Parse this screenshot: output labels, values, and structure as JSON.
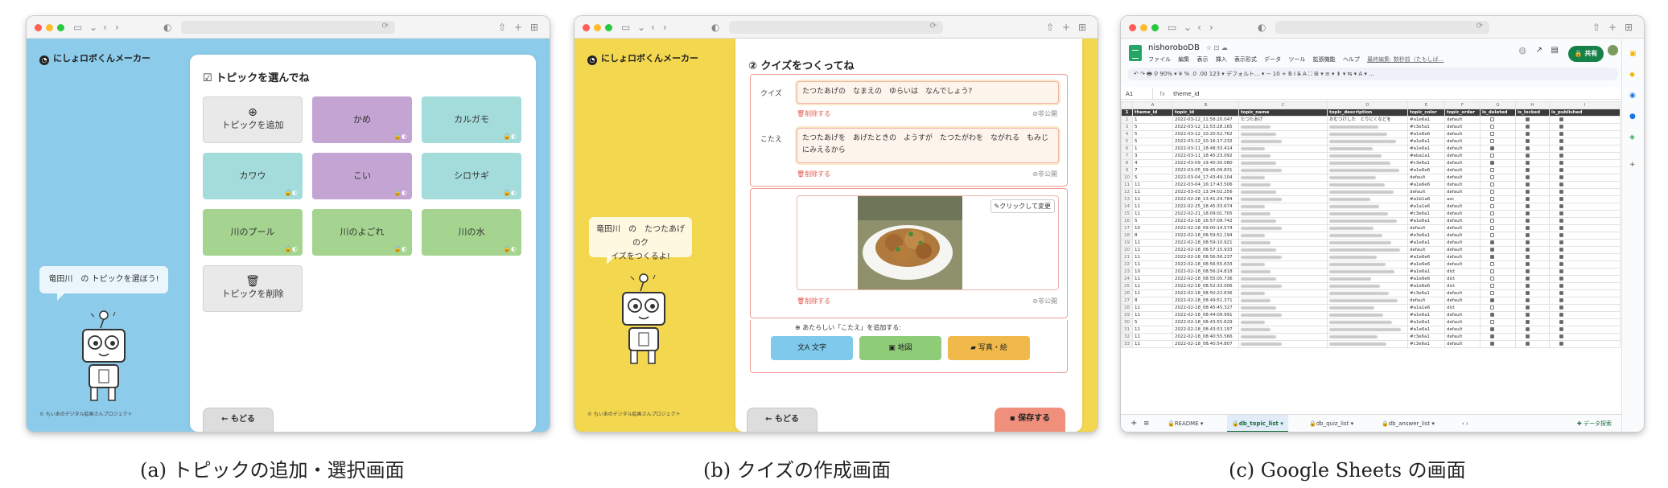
{
  "colors": {
    "sky": "#8ccbea",
    "sun": "#f3d74f",
    "purple": "#c3a4d2",
    "teal": "#a4dcdc",
    "green": "#a4d48f",
    "save": "#ef8f7c",
    "sheet_green": "#17814a"
  },
  "browser": {
    "address_placeholder": "",
    "icons": [
      "sidebar-icon",
      "back-icon",
      "forward-icon",
      "shield-icon",
      "share-icon",
      "new-tab-icon",
      "tabs-overview-icon"
    ]
  },
  "panel_a": {
    "brand": "にしょロボくんメーカー",
    "title": "トピックを選んでね",
    "add_topic": "トピックを追加",
    "delete_topic": "トピックを削除",
    "topics": [
      {
        "label": "かめ",
        "color": "purple"
      },
      {
        "label": "カルガモ",
        "color": "teal"
      },
      {
        "label": "カワウ",
        "color": "teal"
      },
      {
        "label": "こい",
        "color": "purple"
      },
      {
        "label": "シロサギ",
        "color": "teal"
      },
      {
        "label": "川のプール",
        "color": "green"
      },
      {
        "label": "川のよごれ",
        "color": "green"
      },
      {
        "label": "川の水",
        "color": "green"
      }
    ],
    "speech": "竜田川　の トピックを選ぼう!",
    "credit": "© もいあのデジタル絵画さんプロジェクト",
    "back": "← もどる",
    "caption": "(a) トピックの追加・選択画面"
  },
  "panel_b": {
    "brand": "にしょロボくんメーカー",
    "title": "② クイズをつくってね",
    "quiz_label": "クイズ",
    "quiz_text": "たつたあげの　なまえの　ゆらいは　なんでしょう?",
    "answer_label": "こたえ",
    "answer_text": "たつたあげを　あげたときの　ようすが　たつたがわを　ながれる　もみじにみえるから",
    "delete": "削除する",
    "private": "非公開",
    "change_photo": "クリックして変更",
    "add_hint": "あたらしい「こたえ」を追加する:",
    "buttons": [
      {
        "label": "文字",
        "icon": "translate-icon",
        "color": "#7ec9ec"
      },
      {
        "label": "地図",
        "icon": "map-icon",
        "color": "#8fcc77"
      },
      {
        "label": "写真・絵",
        "icon": "image-icon",
        "color": "#f0b94a"
      }
    ],
    "speech": "竜田川　の　たつたあげ　のク\nイズをつくるよ!",
    "credit": "© もいあのデジタル絵画さんプロジェクト",
    "back": "← もどる",
    "save": "保存する",
    "caption": "(b) クイズの作成画面"
  },
  "panel_c": {
    "file_name": "nishoroboDB",
    "menu": [
      "ファイル",
      "編集",
      "表示",
      "挿入",
      "表示形式",
      "データ",
      "ツール",
      "拡張機能",
      "ヘルプ"
    ],
    "last_edit": "最終編集: 数秒前（たもしば...",
    "share": "共有",
    "toolbar": "↶ ↷ 🖶 ⚲   90% ▾   ¥  %  .0  .00  123 ▾   デフォルト... ▾   −  10  +   B  I  S̶  A   ⛶  ⊞  ▾   ≡ ▾  ⇟ ▾  ⇆ ▾  A ▾   ...",
    "cell_ref": "A1",
    "cell_value": "theme_id",
    "columns": [
      "A",
      "B",
      "C",
      "D",
      "E",
      "F",
      "G",
      "H",
      "I"
    ],
    "headers": [
      "theme_id",
      "topic_id",
      "topic_name",
      "topic_description",
      "topic_color",
      "topic_order",
      "is_deleted",
      "is_locked",
      "is_published"
    ],
    "rows": [
      [
        "1",
        "2022-03-12_11:58:20.047",
        "たつたあげ",
        "おむつけした　とりにくなどを",
        "#a1e6a1",
        "default",
        0,
        1,
        1
      ],
      [
        "5",
        "2022-03-12_11:53:28.165",
        "",
        "",
        "#c3e5a1",
        "default",
        0,
        1,
        1
      ],
      [
        "5",
        "2022-03-12_10:20:52.762",
        "",
        "",
        "#a1e6e6",
        "default",
        0,
        1,
        1
      ],
      [
        "5",
        "2022-03-12_10:16:17.232",
        "",
        "",
        "#a1e6a1",
        "default",
        0,
        1,
        1
      ],
      [
        "1",
        "2022-03-11_18:48:33.414",
        "",
        "",
        "#a1e6a1",
        "default",
        1,
        1,
        1
      ],
      [
        "3",
        "2022-03-11_18:45:23.092",
        "",
        "",
        "#eba1a1",
        "default",
        0,
        1,
        1
      ],
      [
        "4",
        "2022-03-09_19:40:30.080",
        "",
        "",
        "#c3e6a1",
        "default",
        1,
        1,
        1
      ],
      [
        "7",
        "2022-03-05_09:45:09.831",
        "",
        "",
        "#a1e6e6",
        "default",
        0,
        1,
        1
      ],
      [
        "5",
        "2022-03-04_17:43:49.104",
        "",
        "",
        "default",
        "default",
        0,
        1,
        1
      ],
      [
        "11",
        "2022-03-04_16:17:43.506",
        "",
        "",
        "#a1e6e6",
        "default",
        0,
        1,
        1
      ],
      [
        "11",
        "2022-03-03_13:34:02.256",
        "",
        "",
        "default",
        "default",
        0,
        1,
        1
      ],
      [
        "11",
        "2022-02-28_13:41:24.784",
        "",
        "",
        "#a1b1a6",
        "asc",
        0,
        1,
        1
      ],
      [
        "11",
        "2022-02-25_18:45:33.674",
        "",
        "",
        "#a1a1e6",
        "default",
        0,
        1,
        1
      ],
      [
        "11",
        "2022-02-21_18:09:01.705",
        "",
        "",
        "#c3e6a1",
        "default",
        0,
        1,
        1
      ],
      [
        "5",
        "2022-02-18_16:57:09.742",
        "",
        "",
        "#a1e6a1",
        "default",
        0,
        1,
        1
      ],
      [
        "10",
        "2022-02-18_09:00:14.574",
        "",
        "",
        "default",
        "default",
        0,
        1,
        1
      ],
      [
        "8",
        "2022-02-18_08:59:51.194",
        "",
        "",
        "#e3e6a1",
        "default",
        0,
        1,
        1
      ],
      [
        "11",
        "2022-02-18_08:59:10.921",
        "",
        "",
        "#a1e6a1",
        "default",
        1,
        1,
        1
      ],
      [
        "11",
        "2022-02-18_08:57:15.933",
        "",
        "",
        "default",
        "default",
        1,
        1,
        1
      ],
      [
        "11",
        "2022-02-18_08:56:56.237",
        "",
        "",
        "#a1e6e6",
        "default",
        1,
        1,
        1
      ],
      [
        "11",
        "2022-02-18_08:56:55.633",
        "",
        "",
        "#a1e6e6",
        "default",
        0,
        1,
        1
      ],
      [
        "10",
        "2022-02-18_08:56:24.818",
        "",
        "",
        "#a1e6a1",
        "dict",
        0,
        1,
        1
      ],
      [
        "11",
        "2022-02-18_08:55:05.736",
        "",
        "",
        "#a1e6e6",
        "dict",
        0,
        1,
        1
      ],
      [
        "11",
        "2022-02-18_08:52:33.006",
        "",
        "",
        "#a1e6e6",
        "dict",
        0,
        1,
        1
      ],
      [
        "11",
        "2022-02-18_08:50:22.636",
        "",
        "",
        "#c3e6a1",
        "default",
        0,
        1,
        1
      ],
      [
        "8",
        "2022-02-18_08:49:51.371",
        "",
        "",
        "default",
        "default",
        1,
        1,
        1
      ],
      [
        "11",
        "2022-02-18_08:45:45.327",
        "",
        "",
        "#a1a1e6",
        "dict",
        0,
        1,
        1
      ],
      [
        "11",
        "2022-02-18_08:44:09.991",
        "",
        "",
        "#a1e6a1",
        "default",
        1,
        1,
        1
      ],
      [
        "5",
        "2022-02-18_08:43:55.629",
        "",
        "",
        "#a1e6a1",
        "default",
        0,
        1,
        1
      ],
      [
        "11",
        "2022-02-18_08:43:53.197",
        "",
        "",
        "#a1e6a1",
        "default",
        1,
        1,
        1
      ],
      [
        "11",
        "2022-02-18_08:40:55.566",
        "",
        "",
        "#c3e6a1",
        "default",
        1,
        1,
        1
      ],
      [
        "11",
        "2022-02-18_08:40:54.807",
        "",
        "",
        "#c3e6a1",
        "default",
        1,
        1,
        1
      ]
    ],
    "tabs": [
      "README",
      "db_topic_list",
      "db_quiz_list",
      "db_answer_list"
    ],
    "active_tab": "db_topic_list",
    "explore": "データ探索",
    "caption": "(c) Google Sheets の画面"
  }
}
